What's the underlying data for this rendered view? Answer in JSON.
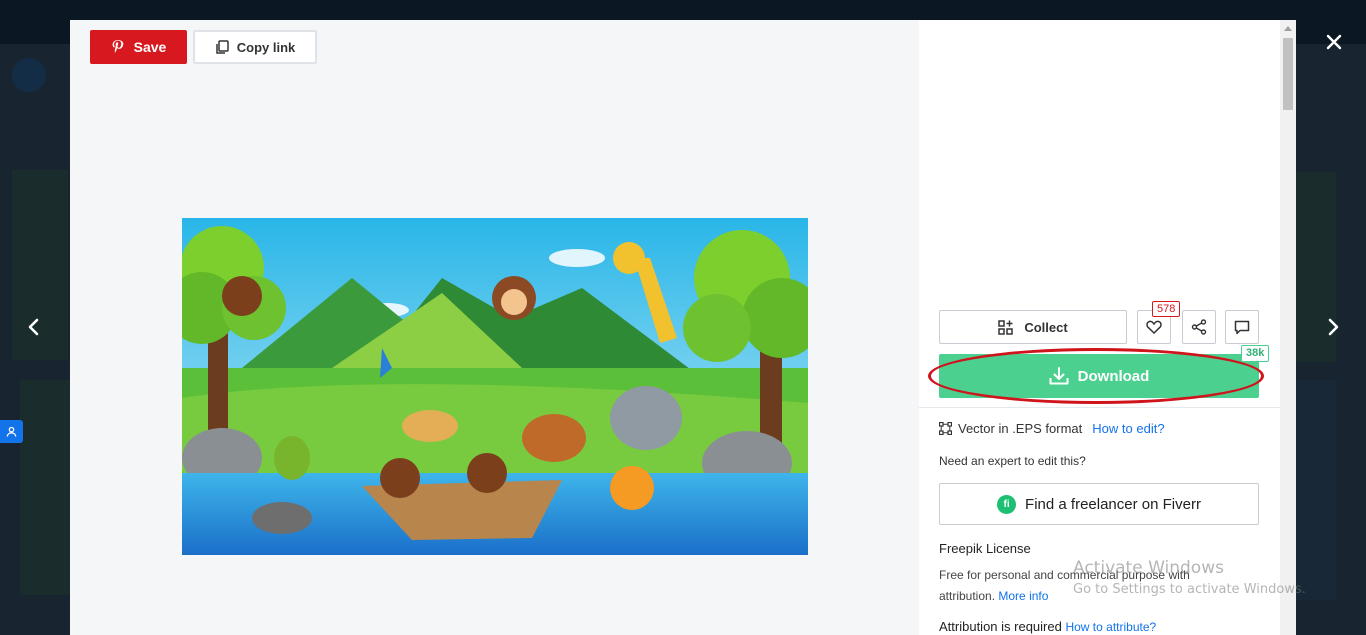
{
  "preview": {
    "save_label": "Save",
    "copy_link_label": "Copy link"
  },
  "sidebar": {
    "collect_label": "Collect",
    "like_count": "578",
    "download_label": "Download",
    "download_count": "38k",
    "format_text": "Vector in .EPS format",
    "how_to_edit_label": "How to edit?",
    "expert_question": "Need an expert to edit this?",
    "fiverr_label": "Find a freelancer on Fiverr",
    "license_title": "Freepik License",
    "license_text": "Free for personal and commercial purpose with attribution.",
    "more_info_label": "More info",
    "attribution_text": "Attribution is required",
    "how_to_attribute_label": "How to attribute?"
  },
  "watermark": {
    "title": "Activate Windows",
    "subtitle": "Go to Settings to activate Windows."
  },
  "colors": {
    "save_red": "#d7181f",
    "download_green": "#4bd090",
    "link_blue": "#1273eb",
    "annotation_red": "#d0141c"
  },
  "icons": {
    "close": "close-icon",
    "prev": "chevron-left-icon",
    "next": "chevron-right-icon",
    "pinterest": "pinterest-icon",
    "copy": "copy-icon",
    "collect": "collection-add-icon",
    "like": "heart-icon",
    "share": "share-icon",
    "comment": "comment-icon",
    "download": "download-icon",
    "format": "vector-format-icon",
    "fiverr": "fiverr-icon",
    "user": "user-icon"
  }
}
